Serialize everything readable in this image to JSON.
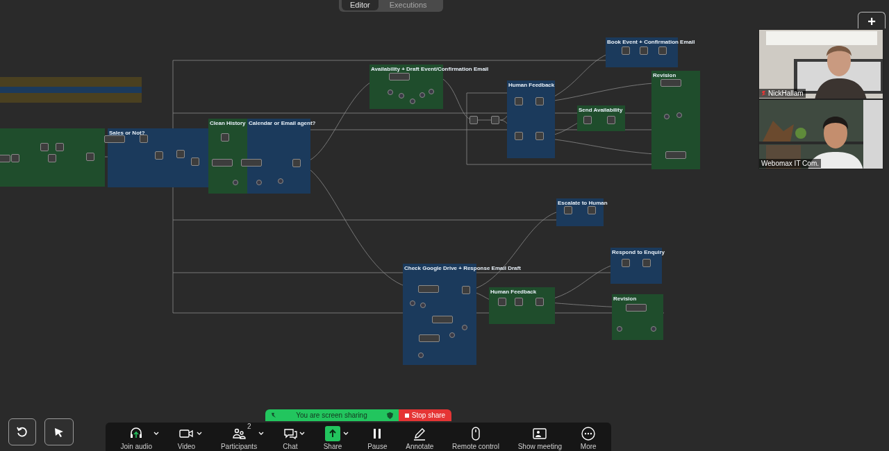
{
  "tabs": [
    {
      "label": "Editor",
      "selected": true
    },
    {
      "label": "Executions",
      "selected": false
    }
  ],
  "add_button": {
    "label": "+"
  },
  "groups": [
    {
      "color": "#1f4d2c"
    },
    {
      "title": "Sales or Not?",
      "color": "#1b3a5c"
    },
    {
      "title": "Clean History",
      "color": "#1f4d2c"
    },
    {
      "title": "Calendar or Email agent?",
      "color": "#1b3a5c"
    },
    {
      "title": "Availability + Draft Event/Confirmation Email",
      "color": "#1f4d2c"
    },
    {
      "title": "Human Feedback",
      "color": "#1b3a5c"
    },
    {
      "title": "Book Event + Confirmation Email",
      "color": "#1b3a5c"
    },
    {
      "title": "Send Availability",
      "color": "#1f4d2c"
    },
    {
      "title": "Revision",
      "color": "#1f4d2c"
    },
    {
      "title": "Escalate to Human",
      "color": "#1b3a5c"
    },
    {
      "title": "Check Google Drive + Response Email Draft",
      "color": "#1b3a5c"
    },
    {
      "title": "Human Feedback",
      "color": "#1f4d2c"
    },
    {
      "title": "Respond to Enquiry",
      "color": "#1b3a5c"
    },
    {
      "title": "Revision",
      "color": "#1f4d2c"
    }
  ],
  "videos": [
    {
      "name": "NickHallam",
      "muted": true
    },
    {
      "name": "Webomax IT Com.",
      "muted": false
    }
  ],
  "sharing_banner": {
    "text": "You are screen sharing",
    "stop": "Stop share"
  },
  "toolbar": [
    {
      "label": "Join audio",
      "caret": true,
      "active": false
    },
    {
      "label": "Video",
      "caret": true,
      "active": false
    },
    {
      "label": "Participants",
      "badge": "2",
      "caret": true,
      "active": false
    },
    {
      "label": "Chat",
      "caret": true,
      "active": false
    },
    {
      "label": "Share",
      "caret": true,
      "active": true
    },
    {
      "label": "Pause",
      "caret": false,
      "active": false
    },
    {
      "label": "Annotate",
      "caret": false,
      "active": false
    },
    {
      "label": "Remote control",
      "caret": false,
      "active": false
    },
    {
      "label": "Show meeting",
      "caret": false,
      "active": false
    },
    {
      "label": "More",
      "caret": false,
      "active": false
    }
  ]
}
